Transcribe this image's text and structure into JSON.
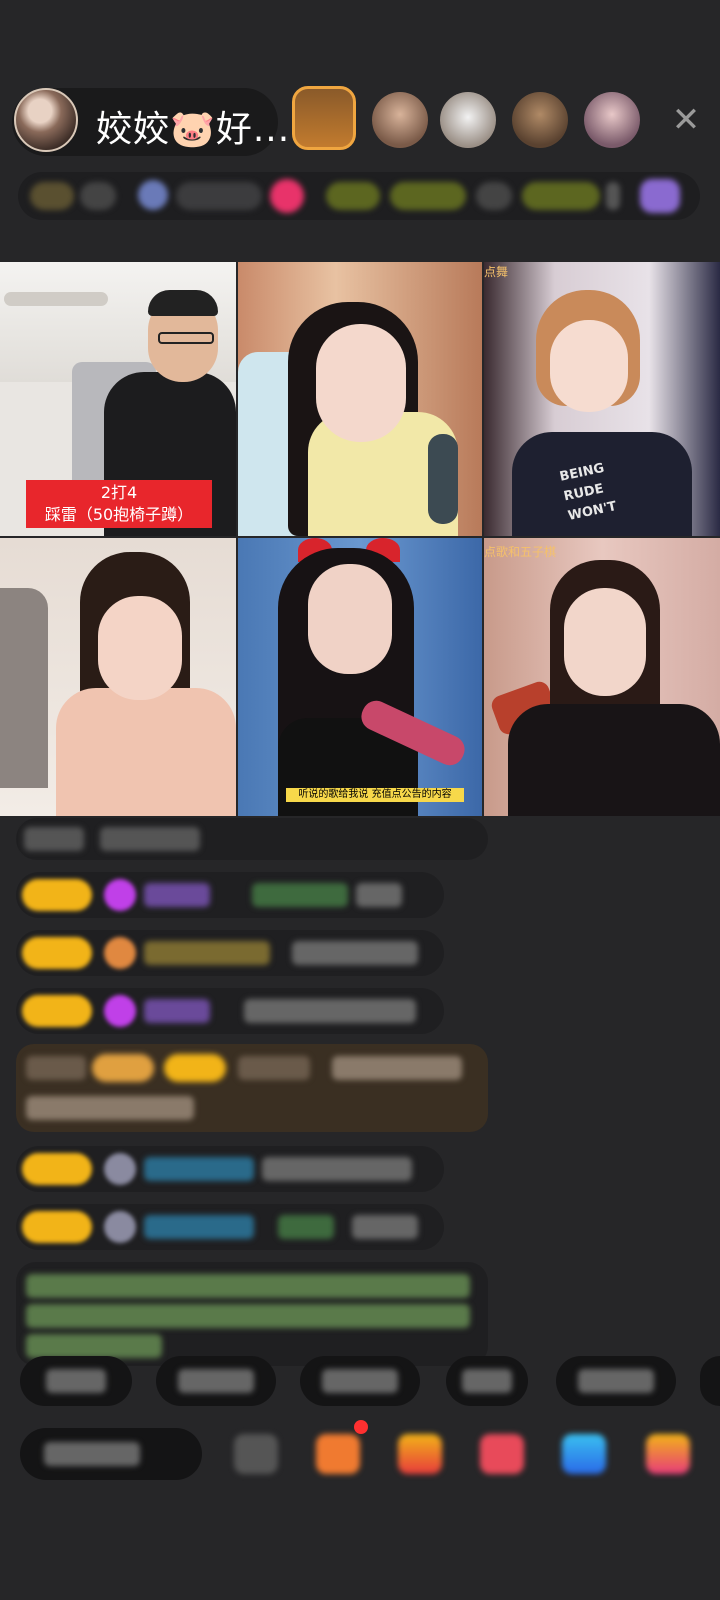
{
  "header": {
    "host_name": "姣姣🐷好...",
    "close_symbol": "✕"
  },
  "video_grid": {
    "tile1_caption_line1": "2打4",
    "tile1_caption_line2": "踩雷（50抱椅子蹲）",
    "tile3_tag": "点舞",
    "tile6_tag": "点歌和五子棋",
    "tile5_subtitle": "听说的歌给我说 充值点公告的内容"
  },
  "colors": {
    "background": "#262628",
    "badge_gold": "#f2b418",
    "caption_red": "#e8262c",
    "chat_bubble": "#1f1f21"
  }
}
